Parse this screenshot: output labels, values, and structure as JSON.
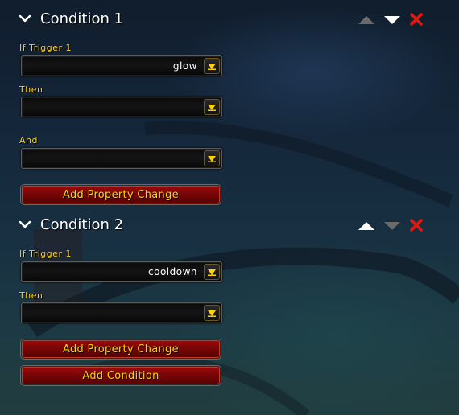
{
  "conditions": [
    {
      "title": "Condition 1",
      "trigger_label": "If Trigger 1",
      "trigger_value": "glow",
      "then_label": "Then",
      "then_value": "",
      "and_label": "And",
      "and_value": "",
      "add_property_label": "Add Property Change"
    },
    {
      "title": "Condition 2",
      "trigger_label": "If Trigger 1",
      "trigger_value": "cooldown",
      "then_label": "Then",
      "then_value": "",
      "add_property_label": "Add Property Change"
    }
  ],
  "add_condition_label": "Add Condition",
  "colors": {
    "label_gold": "#ffd200",
    "button_red": "#7a0606",
    "delete_red": "#e8140e"
  },
  "icons": [
    "chevron-down-icon",
    "move-up-icon",
    "move-down-icon",
    "delete-icon",
    "dropdown-arrow-icon"
  ]
}
